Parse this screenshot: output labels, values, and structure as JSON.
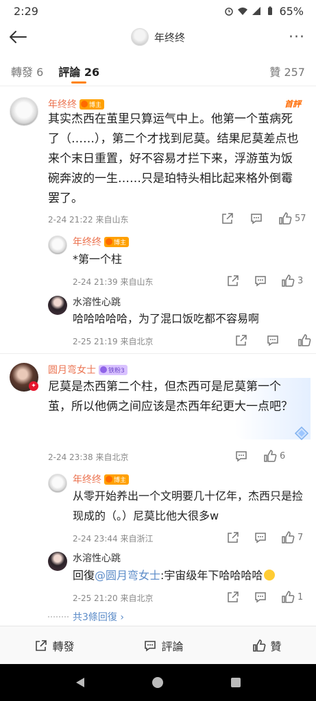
{
  "status_bar": {
    "time": "2:29",
    "battery": "65%"
  },
  "header": {
    "title": "年终终"
  },
  "tabs": {
    "repost": "轉發 6",
    "comments": "評論 26",
    "likes": "贊 257"
  },
  "comments": [
    {
      "user": "年终终",
      "badge": "博主",
      "top_label": "首評",
      "text": "其实杰西在茧里只算运气中上。他第一个茧病死了（……），第二个才找到尼莫。结果尼莫差点也来个末日重置，好不容易才拦下来，浮游茧为饭碗奔波的一生……只是珀特头相比起来格外倒霉罢了。",
      "time": "2-24 21:22",
      "location": "来自山东",
      "likes": "57",
      "replies": [
        {
          "user": "年终终",
          "badge": "博主",
          "text": "*第一个柱",
          "time": "2-24 21:39",
          "location": "来自山东",
          "likes": "3"
        },
        {
          "user": "水溶性心跳",
          "text": "哈哈哈哈哈，为了混口饭吃都不容易啊",
          "time": "2-25 21:19",
          "location": "来自北京",
          "likes": ""
        }
      ]
    },
    {
      "user": "圆月弯女士",
      "badge": "铁粉3",
      "text": "尼莫是杰西第二个柱，但杰西可是尼莫第一个茧，所以他俩之间应该是杰西年纪更大一点吧？",
      "time": "2-24 23:38",
      "location": "来自北京",
      "likes": "6",
      "replies": [
        {
          "user": "年终终",
          "badge": "博主",
          "text": "从零开始养出一个文明要几十亿年，杰西只是捡现成的（。）尼莫比他大很多w",
          "time": "2-24 23:44",
          "location": "来自浙江",
          "likes": "7"
        },
        {
          "user": "水溶性心跳",
          "reply_prefix": "回復",
          "mention": "@圆月弯女士",
          "text": ":宇宙级年下哈哈哈哈",
          "time": "2-25 21:20",
          "location": "来自北京",
          "likes": "1"
        }
      ],
      "more_replies": "共3條回復 ›"
    }
  ],
  "bottom_bar": {
    "repost": "轉發",
    "comment": "評論",
    "like": "贊"
  },
  "colors": {
    "accent": "#ff8200",
    "username": "#eb7350",
    "link": "#5b8bc8"
  }
}
